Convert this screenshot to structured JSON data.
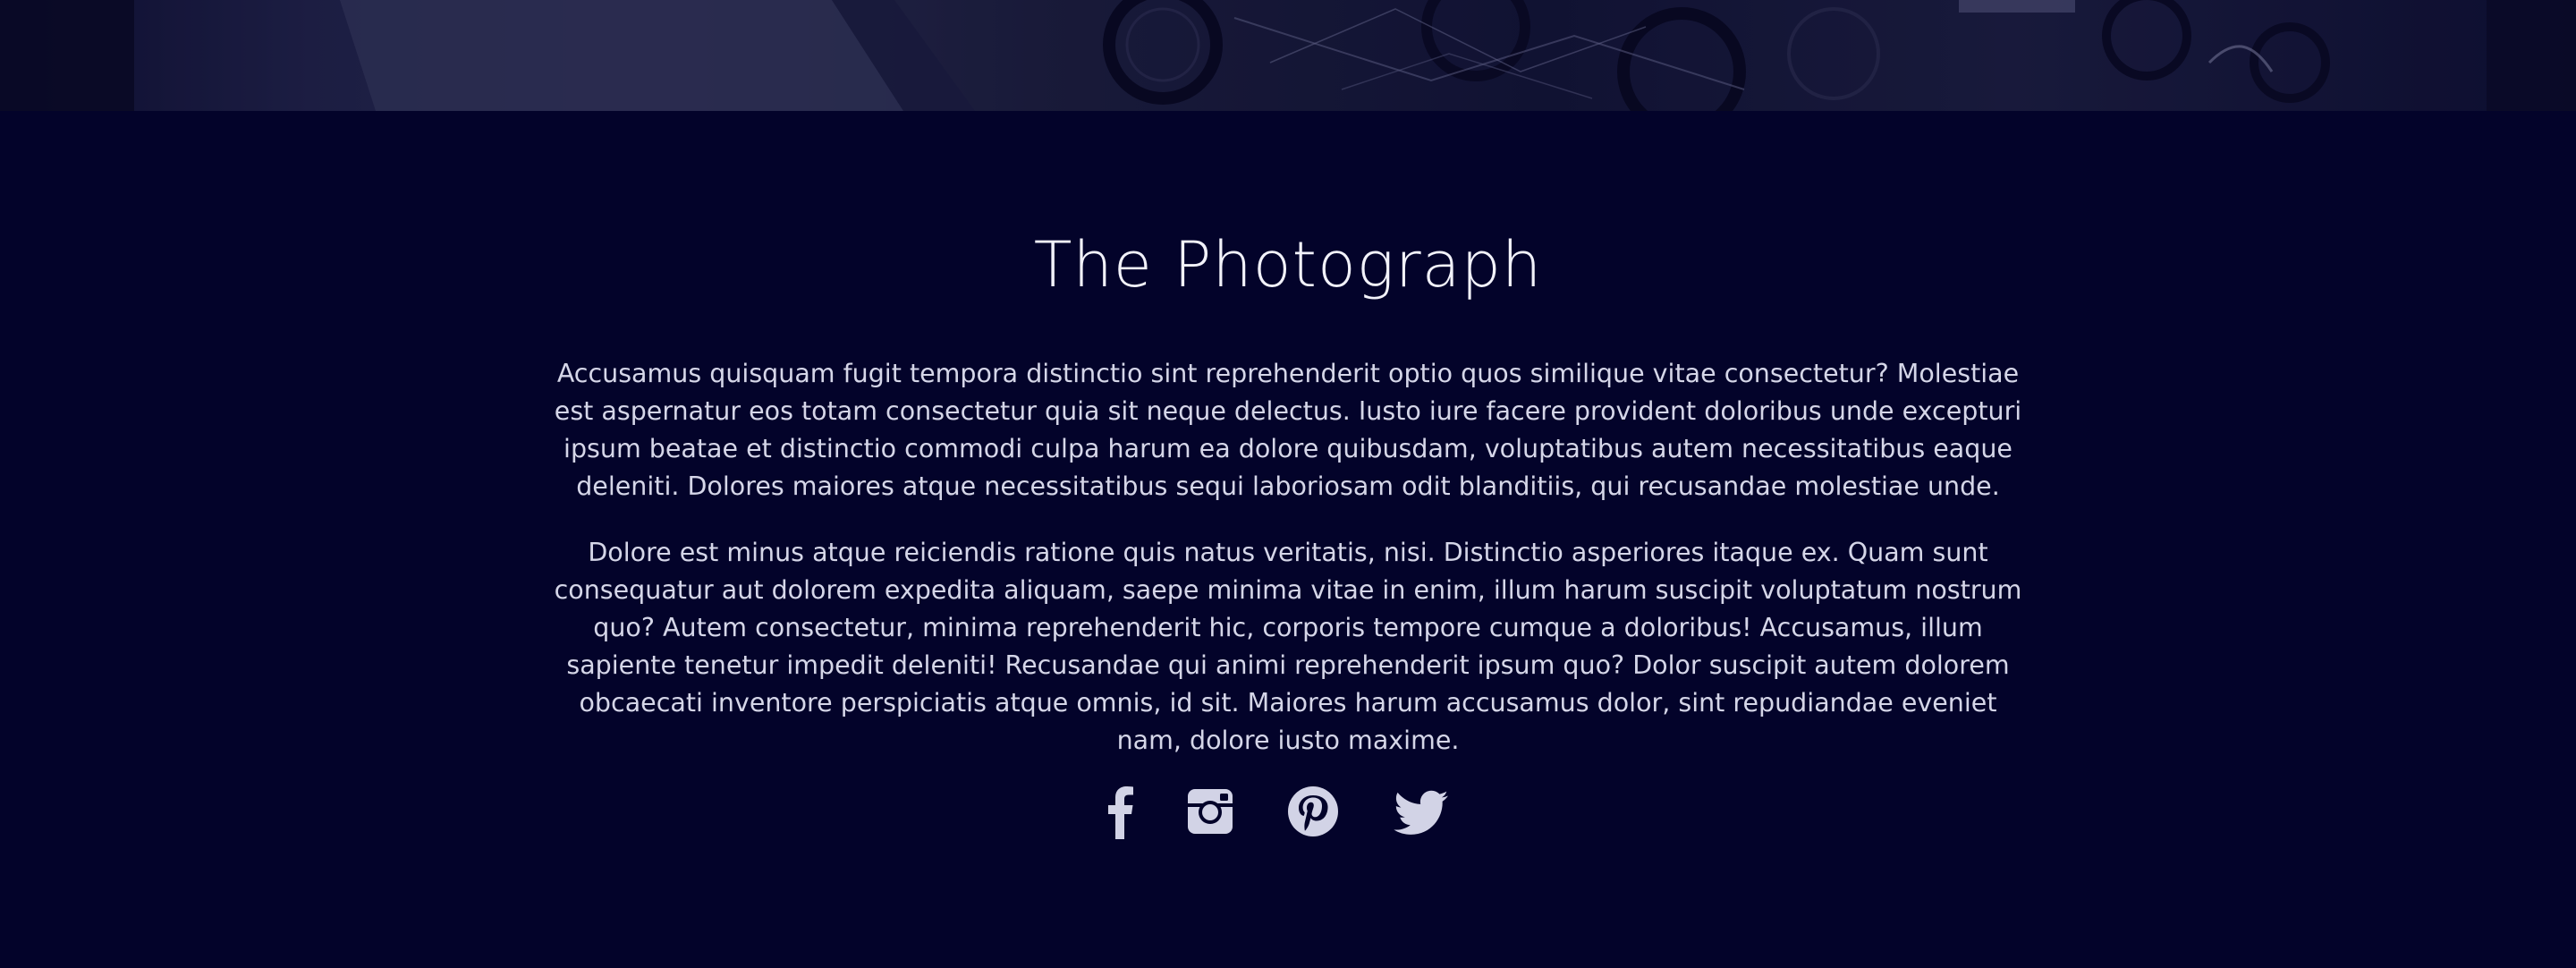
{
  "hero": {
    "image_alt": "dark street photograph with parked motorcycles"
  },
  "main": {
    "title": "The Photograph",
    "paragraphs": [
      "Accusamus quisquam fugit tempora distinctio sint reprehenderit optio quos similique vitae consectetur? Molestiae est aspernatur eos totam consectetur quia sit neque delectus. Iusto iure facere provident doloribus unde excepturi ipsum beatae et distinctio commodi culpa harum ea dolore quibusdam, voluptatibus autem necessitatibus eaque deleniti. Dolores maiores atque necessitatibus sequi laboriosam odit blanditiis, qui recusandae molestiae unde.",
      "Dolore est minus atque reiciendis ratione quis natus veritatis, nisi. Distinctio asperiores itaque ex. Quam sunt consequatur aut dolorem expedita aliquam, saepe minima vitae in enim, illum harum suscipit voluptatum nostrum quo? Autem consectetur, minima reprehenderit hic, corporis tempore cumque a doloribus! Accusamus, illum sapiente tenetur impedit deleniti! Recusandae qui animi reprehenderit ipsum quo? Dolor suscipit autem dolorem obcaecati inventore perspiciatis atque omnis, id sit. Maiores harum accusamus dolor, sint repudiandae eveniet nam, dolore iusto maxime."
    ]
  },
  "socials": [
    {
      "icon": "facebook-icon"
    },
    {
      "icon": "instagram-icon"
    },
    {
      "icon": "pinterest-icon"
    },
    {
      "icon": "twitter-icon"
    }
  ],
  "colors": {
    "background": "#03032a",
    "text": "#d5d6e8",
    "title": "#f2f2fa",
    "icon": "#d2d3e6"
  }
}
